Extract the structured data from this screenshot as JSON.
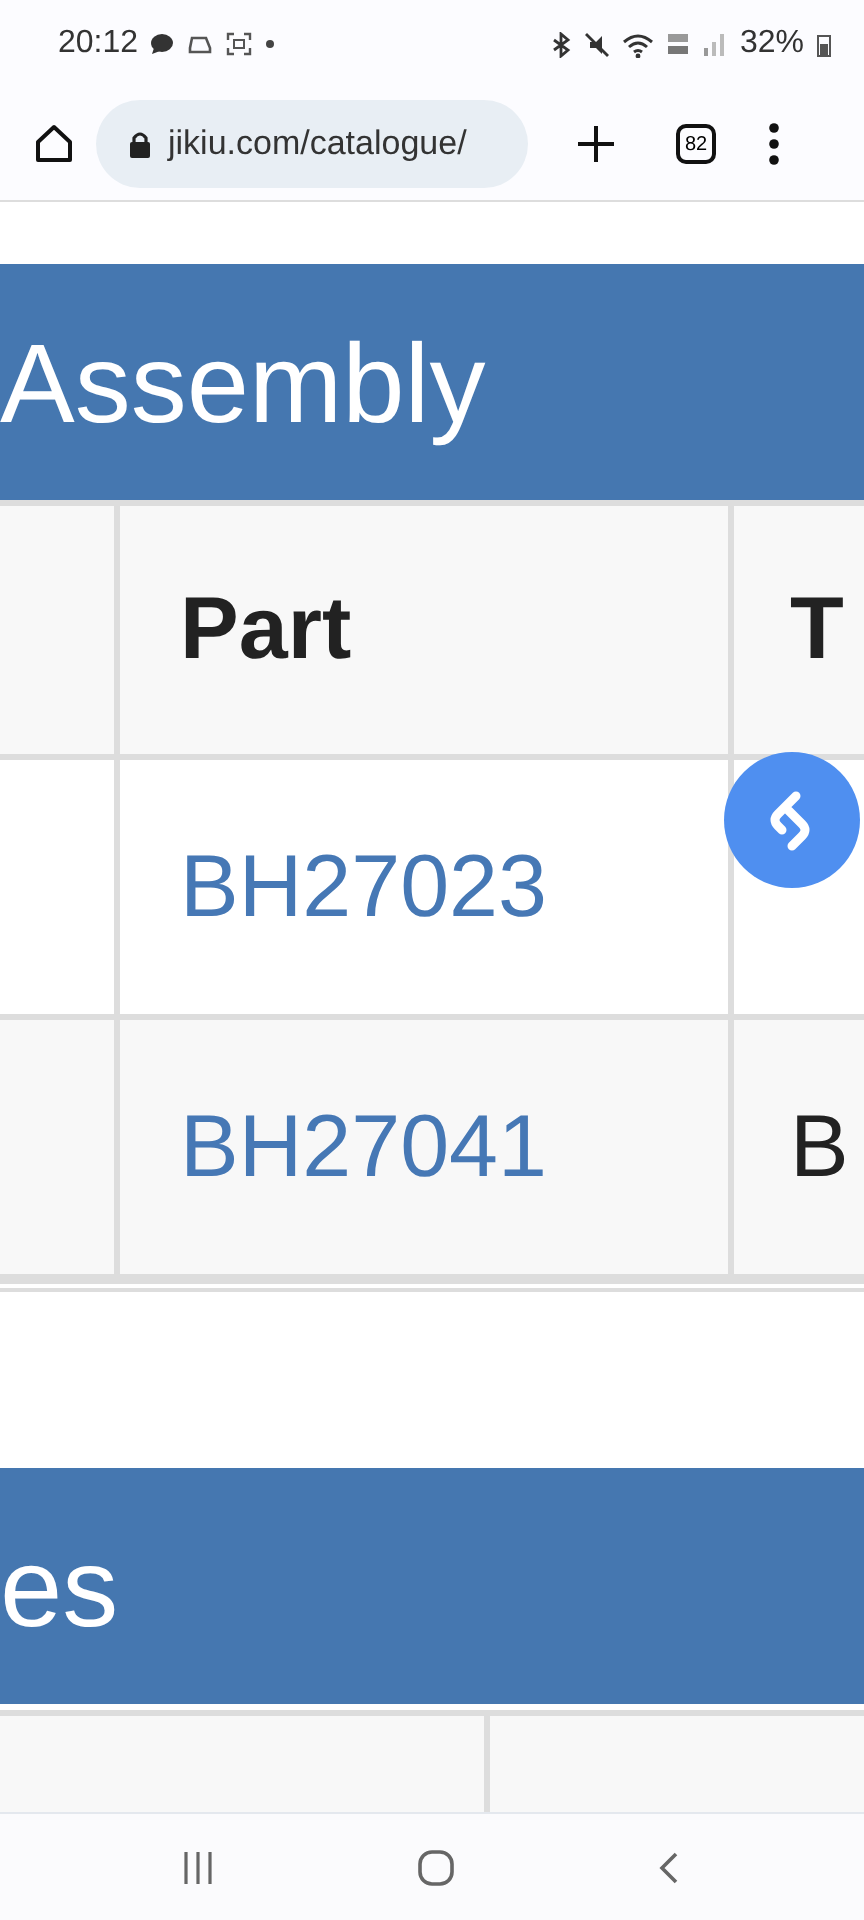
{
  "status_bar": {
    "time": "20:12",
    "battery": "32%"
  },
  "browser": {
    "url": "jikiu.com/catalogue/",
    "tab_count": "82"
  },
  "sections": [
    {
      "heading": "Assembly",
      "table": {
        "header": {
          "part": "Part",
          "type": "T"
        },
        "rows": [
          {
            "part": "BH27023"
          },
          {
            "part": "BH27041",
            "type": "B"
          }
        ]
      }
    },
    {
      "heading": "es"
    }
  ]
}
